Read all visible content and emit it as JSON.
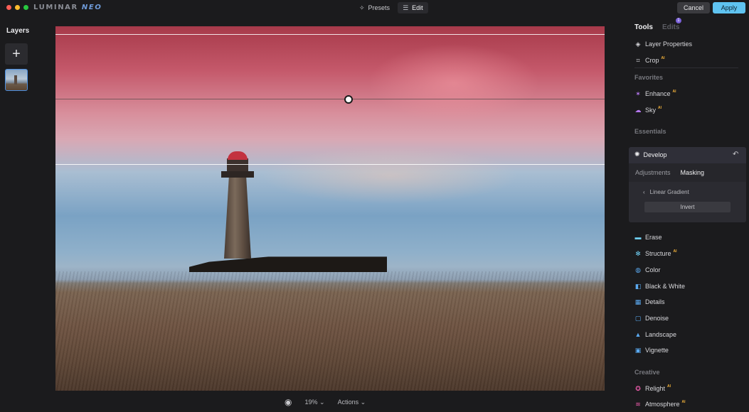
{
  "topbar": {
    "logo_main": "LUMINAR",
    "logo_neo": "NEO",
    "mode_tabs": [
      {
        "label": "Presets",
        "icon": "presets-icon"
      },
      {
        "label": "Edit",
        "icon": "sliders-icon"
      }
    ],
    "cancel_label": "Cancel",
    "apply_label": "Apply",
    "colors": {
      "apply": "#5fc3f0",
      "cancel": "#3a3a3e"
    }
  },
  "layers": {
    "title": "Layers",
    "add_icon": "+"
  },
  "bottom_bar": {
    "zoom": "19%",
    "actions_label": "Actions"
  },
  "tools_panel": {
    "tab_tools": "Tools",
    "tab_edits": "Edits",
    "edits_badge": "1",
    "top_tools": [
      {
        "label": "Layer Properties",
        "icon": "layers-icon"
      },
      {
        "label": "Crop",
        "icon": "crop-icon",
        "ai": "AI"
      }
    ],
    "favorites_title": "Favorites",
    "favorites": [
      {
        "label": "Enhance",
        "icon": "sparkle-icon",
        "ai": "AI"
      },
      {
        "label": "Sky",
        "icon": "cloud-icon",
        "ai": "AI"
      }
    ],
    "essentials_title": "Essentials",
    "develop": {
      "title": "Develop",
      "tabs": [
        "Adjustments",
        "Masking"
      ],
      "active_tab": "Masking",
      "mask_label": "Linear Gradient",
      "invert_label": "Invert"
    },
    "essentials": [
      {
        "label": "Erase",
        "icon": "eraser-icon"
      },
      {
        "label": "Structure",
        "icon": "structure-icon",
        "ai": "AI"
      },
      {
        "label": "Color",
        "icon": "color-icon"
      },
      {
        "label": "Black & White",
        "icon": "black-white-icon"
      },
      {
        "label": "Details",
        "icon": "details-icon"
      },
      {
        "label": "Denoise",
        "icon": "denoise-icon"
      },
      {
        "label": "Landscape",
        "icon": "landscape-icon"
      },
      {
        "label": "Vignette",
        "icon": "vignette-icon"
      }
    ],
    "creative_title": "Creative",
    "creative": [
      {
        "label": "Relight",
        "icon": "relight-icon",
        "ai": "AI"
      },
      {
        "label": "Atmosphere",
        "icon": "atmosphere-icon",
        "ai": "AI"
      }
    ]
  }
}
